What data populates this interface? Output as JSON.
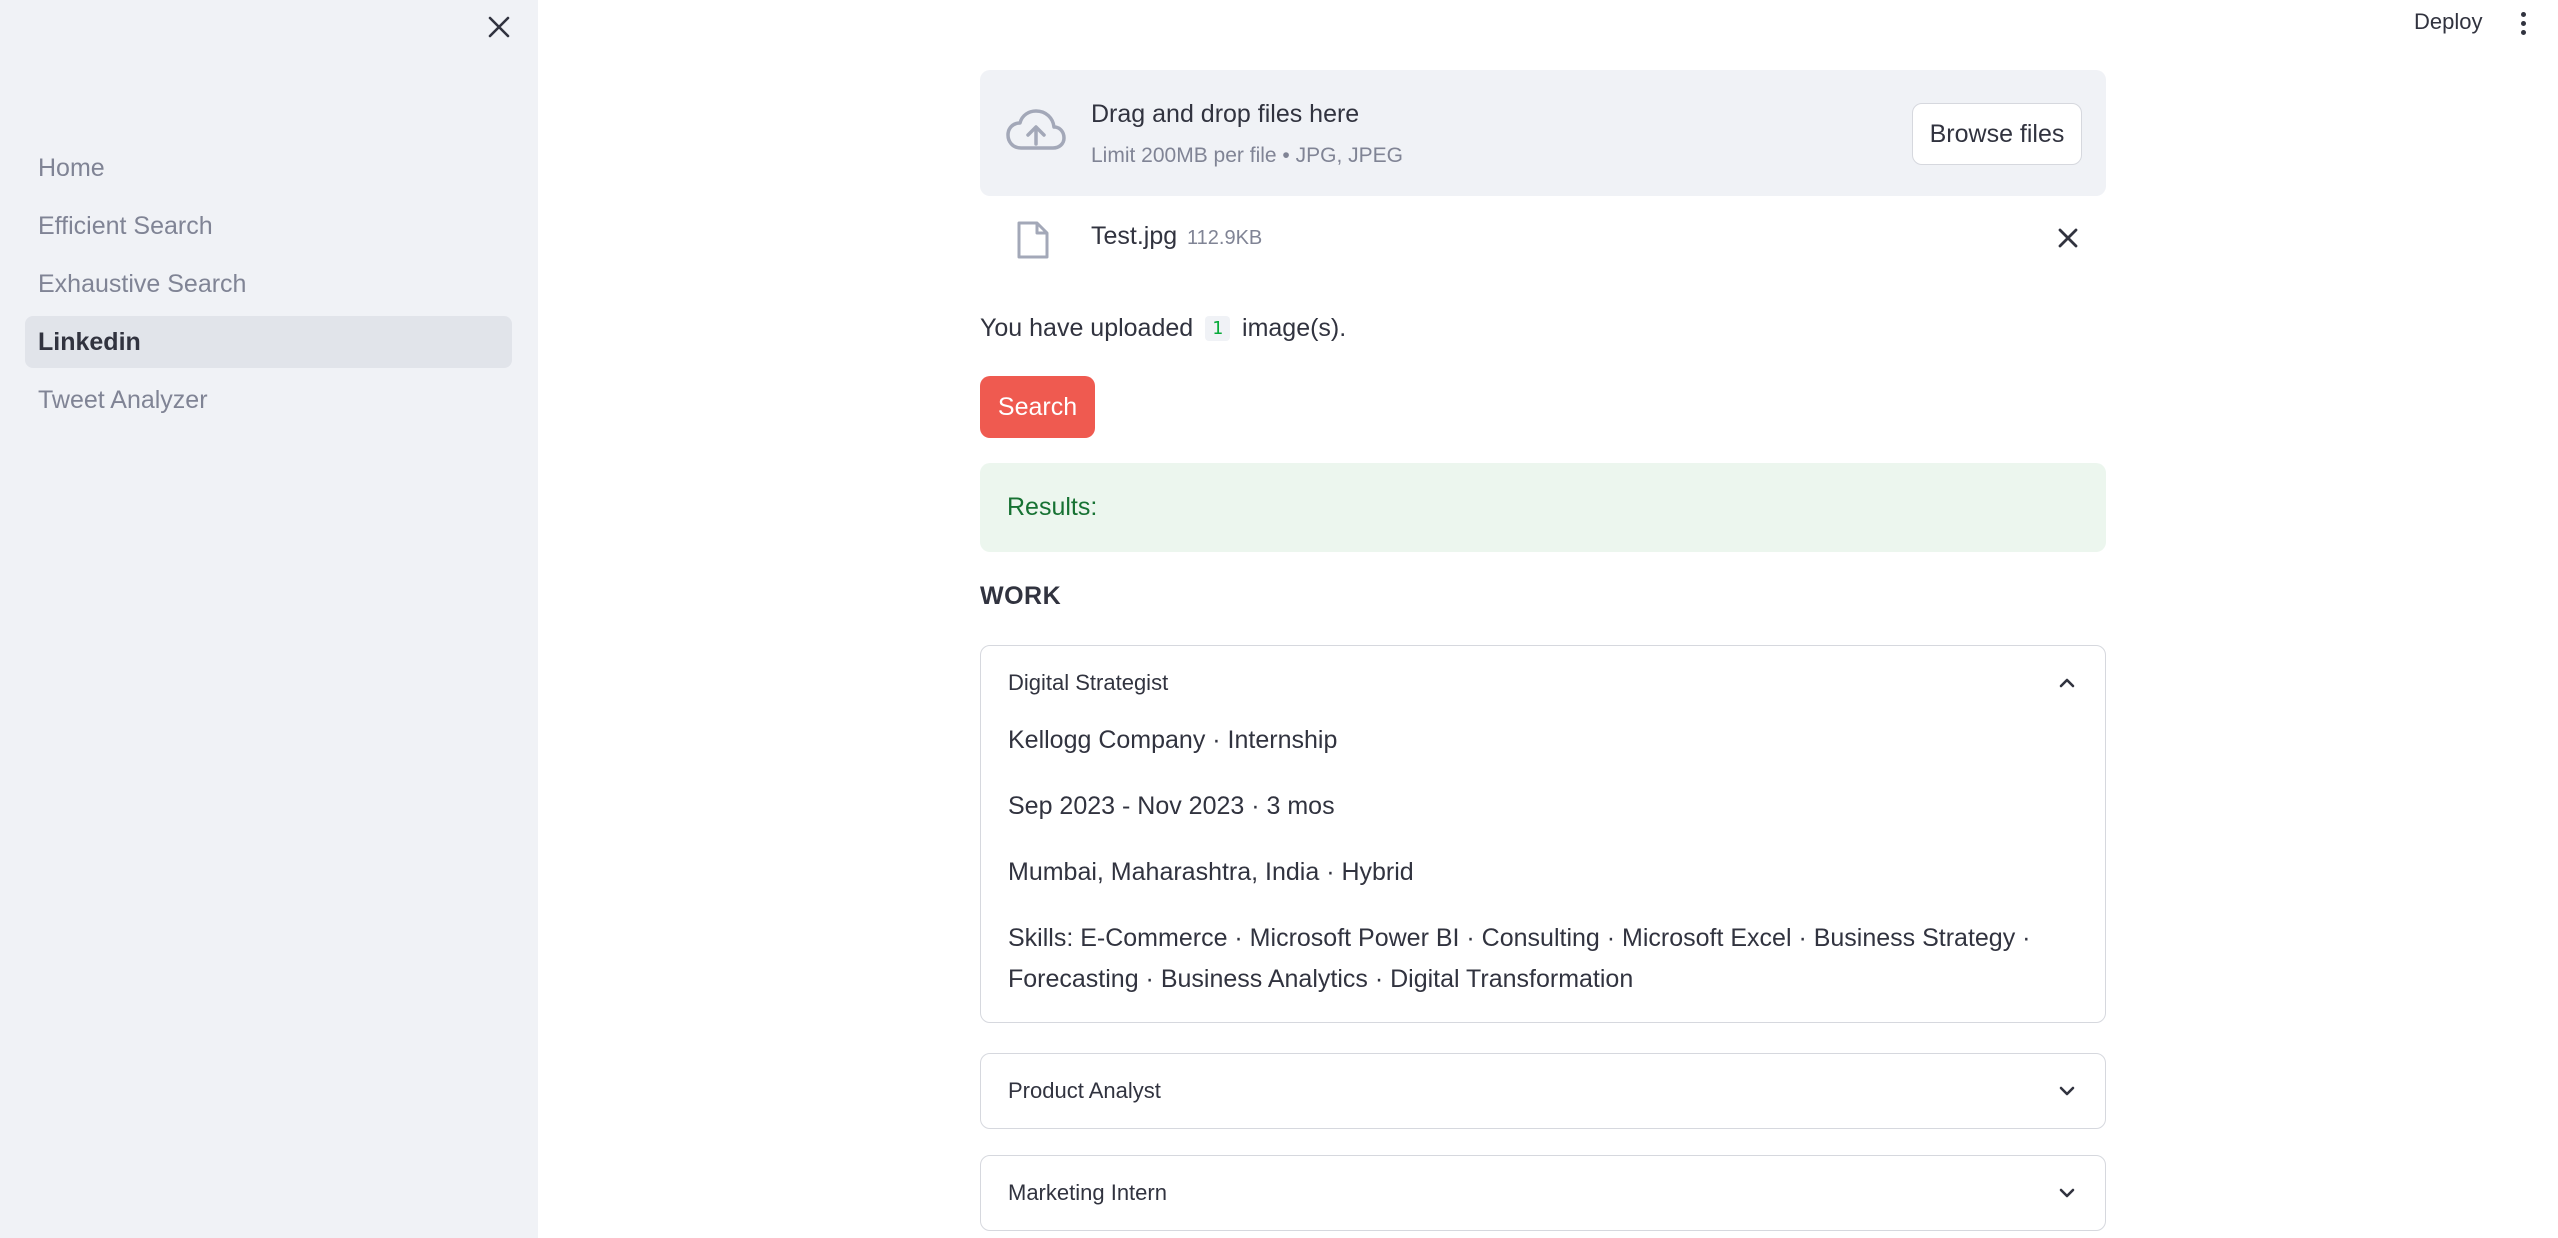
{
  "sidebar": {
    "items": [
      {
        "label": "Home",
        "active": false
      },
      {
        "label": "Efficient Search",
        "active": false
      },
      {
        "label": "Exhaustive Search",
        "active": false
      },
      {
        "label": "Linkedin",
        "active": true
      },
      {
        "label": "Tweet Analyzer",
        "active": false
      }
    ]
  },
  "header": {
    "deploy_label": "Deploy"
  },
  "uploader": {
    "title": "Drag and drop files here",
    "subtitle": "Limit 200MB per file • JPG, JPEG",
    "browse_label": "Browse files",
    "file": {
      "name": "Test.jpg",
      "size": "112.9KB"
    }
  },
  "upload_status": {
    "prefix": "You have uploaded",
    "count": "1",
    "suffix": "image(s)."
  },
  "search_label": "Search",
  "results_label": "Results:",
  "work_heading": "WORK",
  "expanders": [
    {
      "title": "Digital Strategist",
      "expanded": true,
      "lines": [
        "Kellogg Company · Internship",
        "Sep 2023 - Nov 2023 · 3 mos",
        "Mumbai, Maharashtra, India · Hybrid",
        "Skills: E-Commerce · Microsoft Power BI · Consulting · Microsoft Excel · Business Strategy · Forecasting · Business Analytics · Digital Transformation"
      ]
    },
    {
      "title": "Product Analyst",
      "expanded": false
    },
    {
      "title": "Marketing Intern",
      "expanded": false
    }
  ],
  "colors": {
    "sidebar_bg": "#f0f2f6",
    "primary": "#ef5a50",
    "success_bg": "#ecf6ee",
    "success_text": "#177233"
  },
  "icons": [
    "close-icon",
    "cloud-upload-icon",
    "file-icon",
    "chevron-up-icon",
    "chevron-down-icon",
    "more-vertical-icon"
  ]
}
